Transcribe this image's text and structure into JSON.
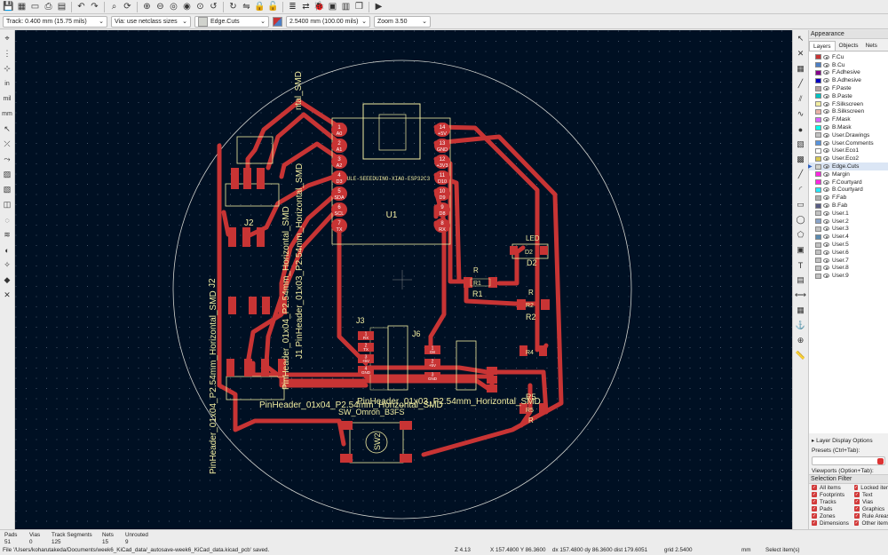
{
  "toolbar": {
    "icons": [
      "save-icon",
      "board-setup-icon",
      "page-settings-icon",
      "print-icon",
      "plot-icon",
      "undo-icon",
      "redo-icon",
      "find-icon",
      "refresh-icon",
      "zoom-in-icon",
      "zoom-out-icon",
      "zoom-fit-icon",
      "zoom-objects-icon",
      "zoom-selection-icon",
      "rotate-ccw-icon",
      "rotate-cw-icon",
      "flip-icon",
      "lock-icon",
      "unlock-icon",
      "netlist-icon",
      "update-pcb-icon",
      "drc-icon",
      "footprint-editor-icon",
      "footprint-browser-icon",
      "3d-viewer-icon",
      "scripting-icon"
    ]
  },
  "aux": {
    "track": "Track: 0.400 mm (15.75 mils)",
    "via": "Via: use netclass sizes",
    "layer": "Edge.Cuts",
    "grid": "2.5400 mm (100.00 mils)",
    "zoom": "Zoom 3.50"
  },
  "left_toolbar": {
    "icons": [
      "select-icon",
      "grid-icon",
      "polar-icon",
      "inch-icon",
      "mil-icon",
      "mm-icon",
      "cursor-icon",
      "ratsnest-icon",
      "ratsnest-curved-icon",
      "zone-fill-icon",
      "zone-outline-icon",
      "pad-outline-icon",
      "via-outline-icon",
      "track-outline-icon",
      "contrast-icon",
      "net-highlight-icon",
      "layers-manager-icon",
      "tools-icon"
    ],
    "labels": [
      "in",
      "mil",
      "mm"
    ]
  },
  "right_toolbar": {
    "icons": [
      "arrow-icon",
      "local-ratsnest-icon",
      "footprint-icon",
      "route-track-icon",
      "route-diff-pair-icon",
      "tune-length-icon",
      "via-icon",
      "zone-icon",
      "rule-area-icon",
      "line-icon",
      "arc-icon",
      "rectangle-icon",
      "circle-icon",
      "polygon-icon",
      "image-icon",
      "text-icon",
      "textbox-icon",
      "dimension-icon",
      "table-icon",
      "anchor-icon",
      "origin-icon",
      "measure-icon"
    ]
  },
  "canvas": {
    "labels": {
      "u1": "U1",
      "module": "MODULE-SEEEDUINO-XIAO-ESP32C3",
      "led": "LED",
      "d2_silk": "D2",
      "d2_fab": "D2",
      "r1": "R1",
      "r1_fab": "R1",
      "r_top": "R",
      "r2": "R2",
      "r2_fab": "R2",
      "r_mid": "R",
      "r_bottom": "R",
      "r4_fab": "R4",
      "r5": "R5",
      "r5_fab": "R5",
      "j3": "J3",
      "j6": "J6",
      "j2": "J2",
      "j2_side": "J2",
      "sw2": "SW2",
      "sw_omron": "SW_Omron_B3FS",
      "pinheader_bottom": "PinHeader_01x04_P2.54mm_Horizontal_SMD",
      "pinheader_overlap": "PinHeader_01x03_P2.54mm_Horizontal_SMD",
      "pinheader_left1": "PinHeader_01x04_P2.54mm_Horizontal_SMD",
      "pinheader_left2": "J1 PinHeader_01x03_P2.54mm_Horizontal_SMD",
      "pinheader_left3": "PinHeader_01x04_P2.54mm_Horizontal_SMD",
      "pinheader_top": "ntal_SMD",
      "xiao_left_pads": [
        {
          "num": "1",
          "name": "A0"
        },
        {
          "num": "2",
          "name": "A1"
        },
        {
          "num": "3",
          "name": "A2"
        },
        {
          "num": "4",
          "name": "D3"
        },
        {
          "num": "5",
          "name": "SDA"
        },
        {
          "num": "6",
          "name": "SCL"
        },
        {
          "num": "7",
          "name": "TX"
        }
      ],
      "xiao_right_pads": [
        {
          "num": "14",
          "name": "+5V"
        },
        {
          "num": "13",
          "name": "GND"
        },
        {
          "num": "12",
          "name": "+3V3"
        },
        {
          "num": "11",
          "name": "D10"
        },
        {
          "num": "10",
          "name": "D9"
        },
        {
          "num": "9",
          "name": "D8"
        },
        {
          "num": "8",
          "name": "RX"
        }
      ],
      "j3_pads": [
        {
          "num": "1",
          "name": "RX"
        },
        {
          "num": "2",
          "name": "TX"
        },
        {
          "num": "3",
          "name": "+5V"
        },
        {
          "num": "4",
          "name": "GND"
        }
      ],
      "j6_pads": [
        {
          "num": "1",
          "name": "D8"
        },
        {
          "num": "2",
          "name": "+5V"
        },
        {
          "num": "3",
          "name": "GND"
        }
      ],
      "vertical_pad_labels": [
        "GND",
        "+3V3",
        "SDA",
        "SCL",
        "D3"
      ],
      "small_pads": [
        "1",
        "2",
        "3",
        "4"
      ]
    },
    "colors": {
      "background": "#001023",
      "copper": "#c83434",
      "silk": "#f2eda1",
      "edge": "#d0d2cd",
      "fab": "#afafaf"
    }
  },
  "panel": {
    "title": "Appearance",
    "tabs": [
      "Layers",
      "Objects",
      "Nets"
    ],
    "layers": [
      {
        "name": "F.Cu",
        "color": "#c83434"
      },
      {
        "name": "B.Cu",
        "color": "#4d7fc4"
      },
      {
        "name": "F.Adhesive",
        "color": "#84008b"
      },
      {
        "name": "B.Adhesive",
        "color": "#0000c2"
      },
      {
        "name": "F.Paste",
        "color": "#b4a0a0"
      },
      {
        "name": "B.Paste",
        "color": "#00c2c2"
      },
      {
        "name": "F.Silkscreen",
        "color": "#f2eda1"
      },
      {
        "name": "B.Silkscreen",
        "color": "#e8b2a7"
      },
      {
        "name": "F.Mask",
        "color": "#d864ff"
      },
      {
        "name": "B.Mask",
        "color": "#02ffee"
      },
      {
        "name": "User.Drawings",
        "color": "#c2c2c2"
      },
      {
        "name": "User.Comments",
        "color": "#5994dc"
      },
      {
        "name": "User.Eco1",
        "color": "#b4db d2"
      },
      {
        "name": "User.Eco2",
        "color": "#d8c852"
      },
      {
        "name": "Edge.Cuts",
        "color": "#d0d2cd"
      },
      {
        "name": "Margin",
        "color": "#ff26e2"
      },
      {
        "name": "F.Courtyard",
        "color": "#ff26e2"
      },
      {
        "name": "B.Courtyard",
        "color": "#26e9ff"
      },
      {
        "name": "F.Fab",
        "color": "#afafaf"
      },
      {
        "name": "B.Fab",
        "color": "#585d84"
      },
      {
        "name": "User.1",
        "color": "#c2c2c2"
      },
      {
        "name": "User.2",
        "color": "#89a3c7"
      },
      {
        "name": "User.3",
        "color": "#c2c2c2"
      },
      {
        "name": "User.4",
        "color": "#5a8ab0"
      },
      {
        "name": "User.5",
        "color": "#c2c2c2"
      },
      {
        "name": "User.6",
        "color": "#c2c2c2"
      },
      {
        "name": "User.7",
        "color": "#c2c2c2"
      },
      {
        "name": "User.8",
        "color": "#c2c2c2"
      },
      {
        "name": "User.9",
        "color": "#c2c2c2"
      }
    ],
    "active_layer": "Edge.Cuts",
    "layer_display_options": "Layer Display Options",
    "presets_label": "Presets (Ctrl+Tab):",
    "viewports_label": "Viewports (Option+Tab):"
  },
  "selection_filter": {
    "title": "Selection Filter",
    "items": [
      "All items",
      "Locked items",
      "Footprints",
      "Text",
      "Tracks",
      "Vias",
      "Pads",
      "Graphics",
      "Zones",
      "Rule Areas",
      "Dimensions",
      "Other items"
    ]
  },
  "status": {
    "columns": [
      {
        "label": "Pads",
        "value": "51"
      },
      {
        "label": "Vias",
        "value": "0"
      },
      {
        "label": "Track Segments",
        "value": "125"
      },
      {
        "label": "Nets",
        "value": "15"
      },
      {
        "label": "Unrouted",
        "value": "9"
      }
    ],
    "message": "File '/Users/koharutakeda/Documents/week6_KiCad_data/_autosave-week6_KiCad_data.kicad_pcb' saved.",
    "z": "Z 4.13",
    "xy": "X 157.4800  Y 86.3600",
    "dxy": "dx 157.4800  dy 86.3600  dist 179.6051",
    "grid": "grid 2.5400",
    "units": "mm",
    "mode": "Select item(s)"
  }
}
